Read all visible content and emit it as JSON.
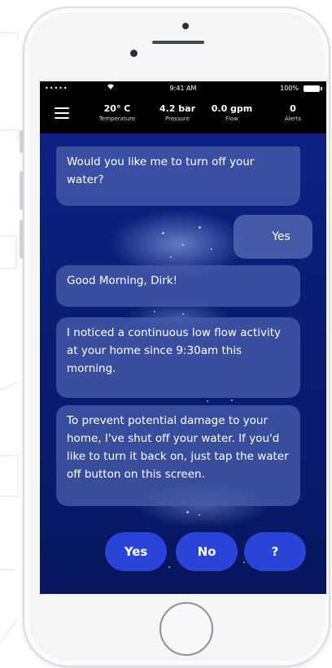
{
  "status_bar": {
    "signal": "•••••",
    "wifi_icon": "wifi-icon",
    "time": "9:41 AM",
    "battery_pct": "100%"
  },
  "metrics": [
    {
      "value": "20° C",
      "label": "Temperature"
    },
    {
      "value": "4.2 bar",
      "label": "Pressure"
    },
    {
      "value": "0.0 gpm",
      "label": "Flow"
    },
    {
      "value": "0",
      "label": "Alerts"
    }
  ],
  "chat": {
    "msg1": "Would you like me to turn off your water?",
    "reply": "Yes",
    "msg2": "Good Morning, Dirk!",
    "msg3": "I noticed a continuous low flow activity at your home since 9:30am this morning.",
    "msg4": "To prevent potential damage to your home, I've shut off your water. If you'd like to turn it back on, just tap the water off button on this screen."
  },
  "answers": {
    "yes": "Yes",
    "no": "No",
    "help": "?"
  },
  "colors": {
    "screen_bg": "#0c1e78",
    "bubble": "#465caa",
    "button": "#2a43d8",
    "header": "#000000"
  }
}
